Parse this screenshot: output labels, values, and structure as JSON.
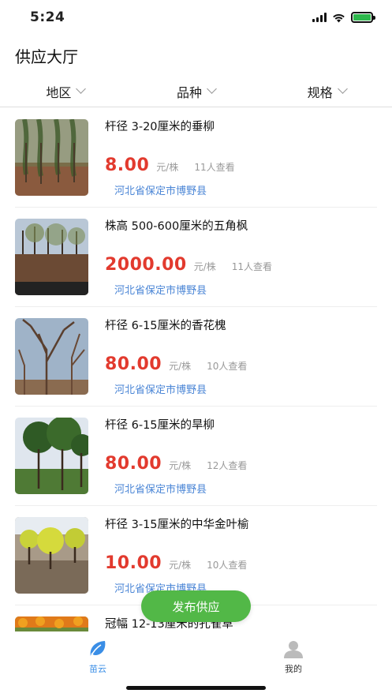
{
  "status_bar": {
    "time": "5:24"
  },
  "page": {
    "title": "供应大厅"
  },
  "filters": [
    {
      "label": "地区"
    },
    {
      "label": "品种"
    },
    {
      "label": "规格"
    }
  ],
  "items": [
    {
      "title": "杆径 3-20厘米的垂柳",
      "price": "8.00",
      "unit": "元/株",
      "views": "11人查看",
      "location": "河北省保定市博野县"
    },
    {
      "title": "株高 500-600厘米的五角枫",
      "price": "2000.00",
      "unit": "元/株",
      "views": "11人查看",
      "location": "河北省保定市博野县"
    },
    {
      "title": "杆径 6-15厘米的香花槐",
      "price": "80.00",
      "unit": "元/株",
      "views": "10人查看",
      "location": "河北省保定市博野县"
    },
    {
      "title": "杆径 6-15厘米的旱柳",
      "price": "80.00",
      "unit": "元/株",
      "views": "12人查看",
      "location": "河北省保定市博野县"
    },
    {
      "title": "杆径 3-15厘米的中华金叶榆",
      "price": "10.00",
      "unit": "元/株",
      "views": "10人查看",
      "location": "河北省保定市博野县"
    },
    {
      "title": "冠幅 12-13厘米的孔雀草",
      "price": "",
      "unit": "",
      "views": "",
      "location": ""
    }
  ],
  "publish_button": {
    "label": "发布供应"
  },
  "tabbar": [
    {
      "label": "苗云",
      "icon": "leaf-icon",
      "active": true,
      "color": "#3a8ee6"
    },
    {
      "label": "我的",
      "icon": "user-icon",
      "active": false,
      "color": "#333333"
    }
  ],
  "colors": {
    "price": "#e23a2e",
    "location": "#4b86d6",
    "publish": "#52b847",
    "tab_active": "#3a8ee6"
  }
}
